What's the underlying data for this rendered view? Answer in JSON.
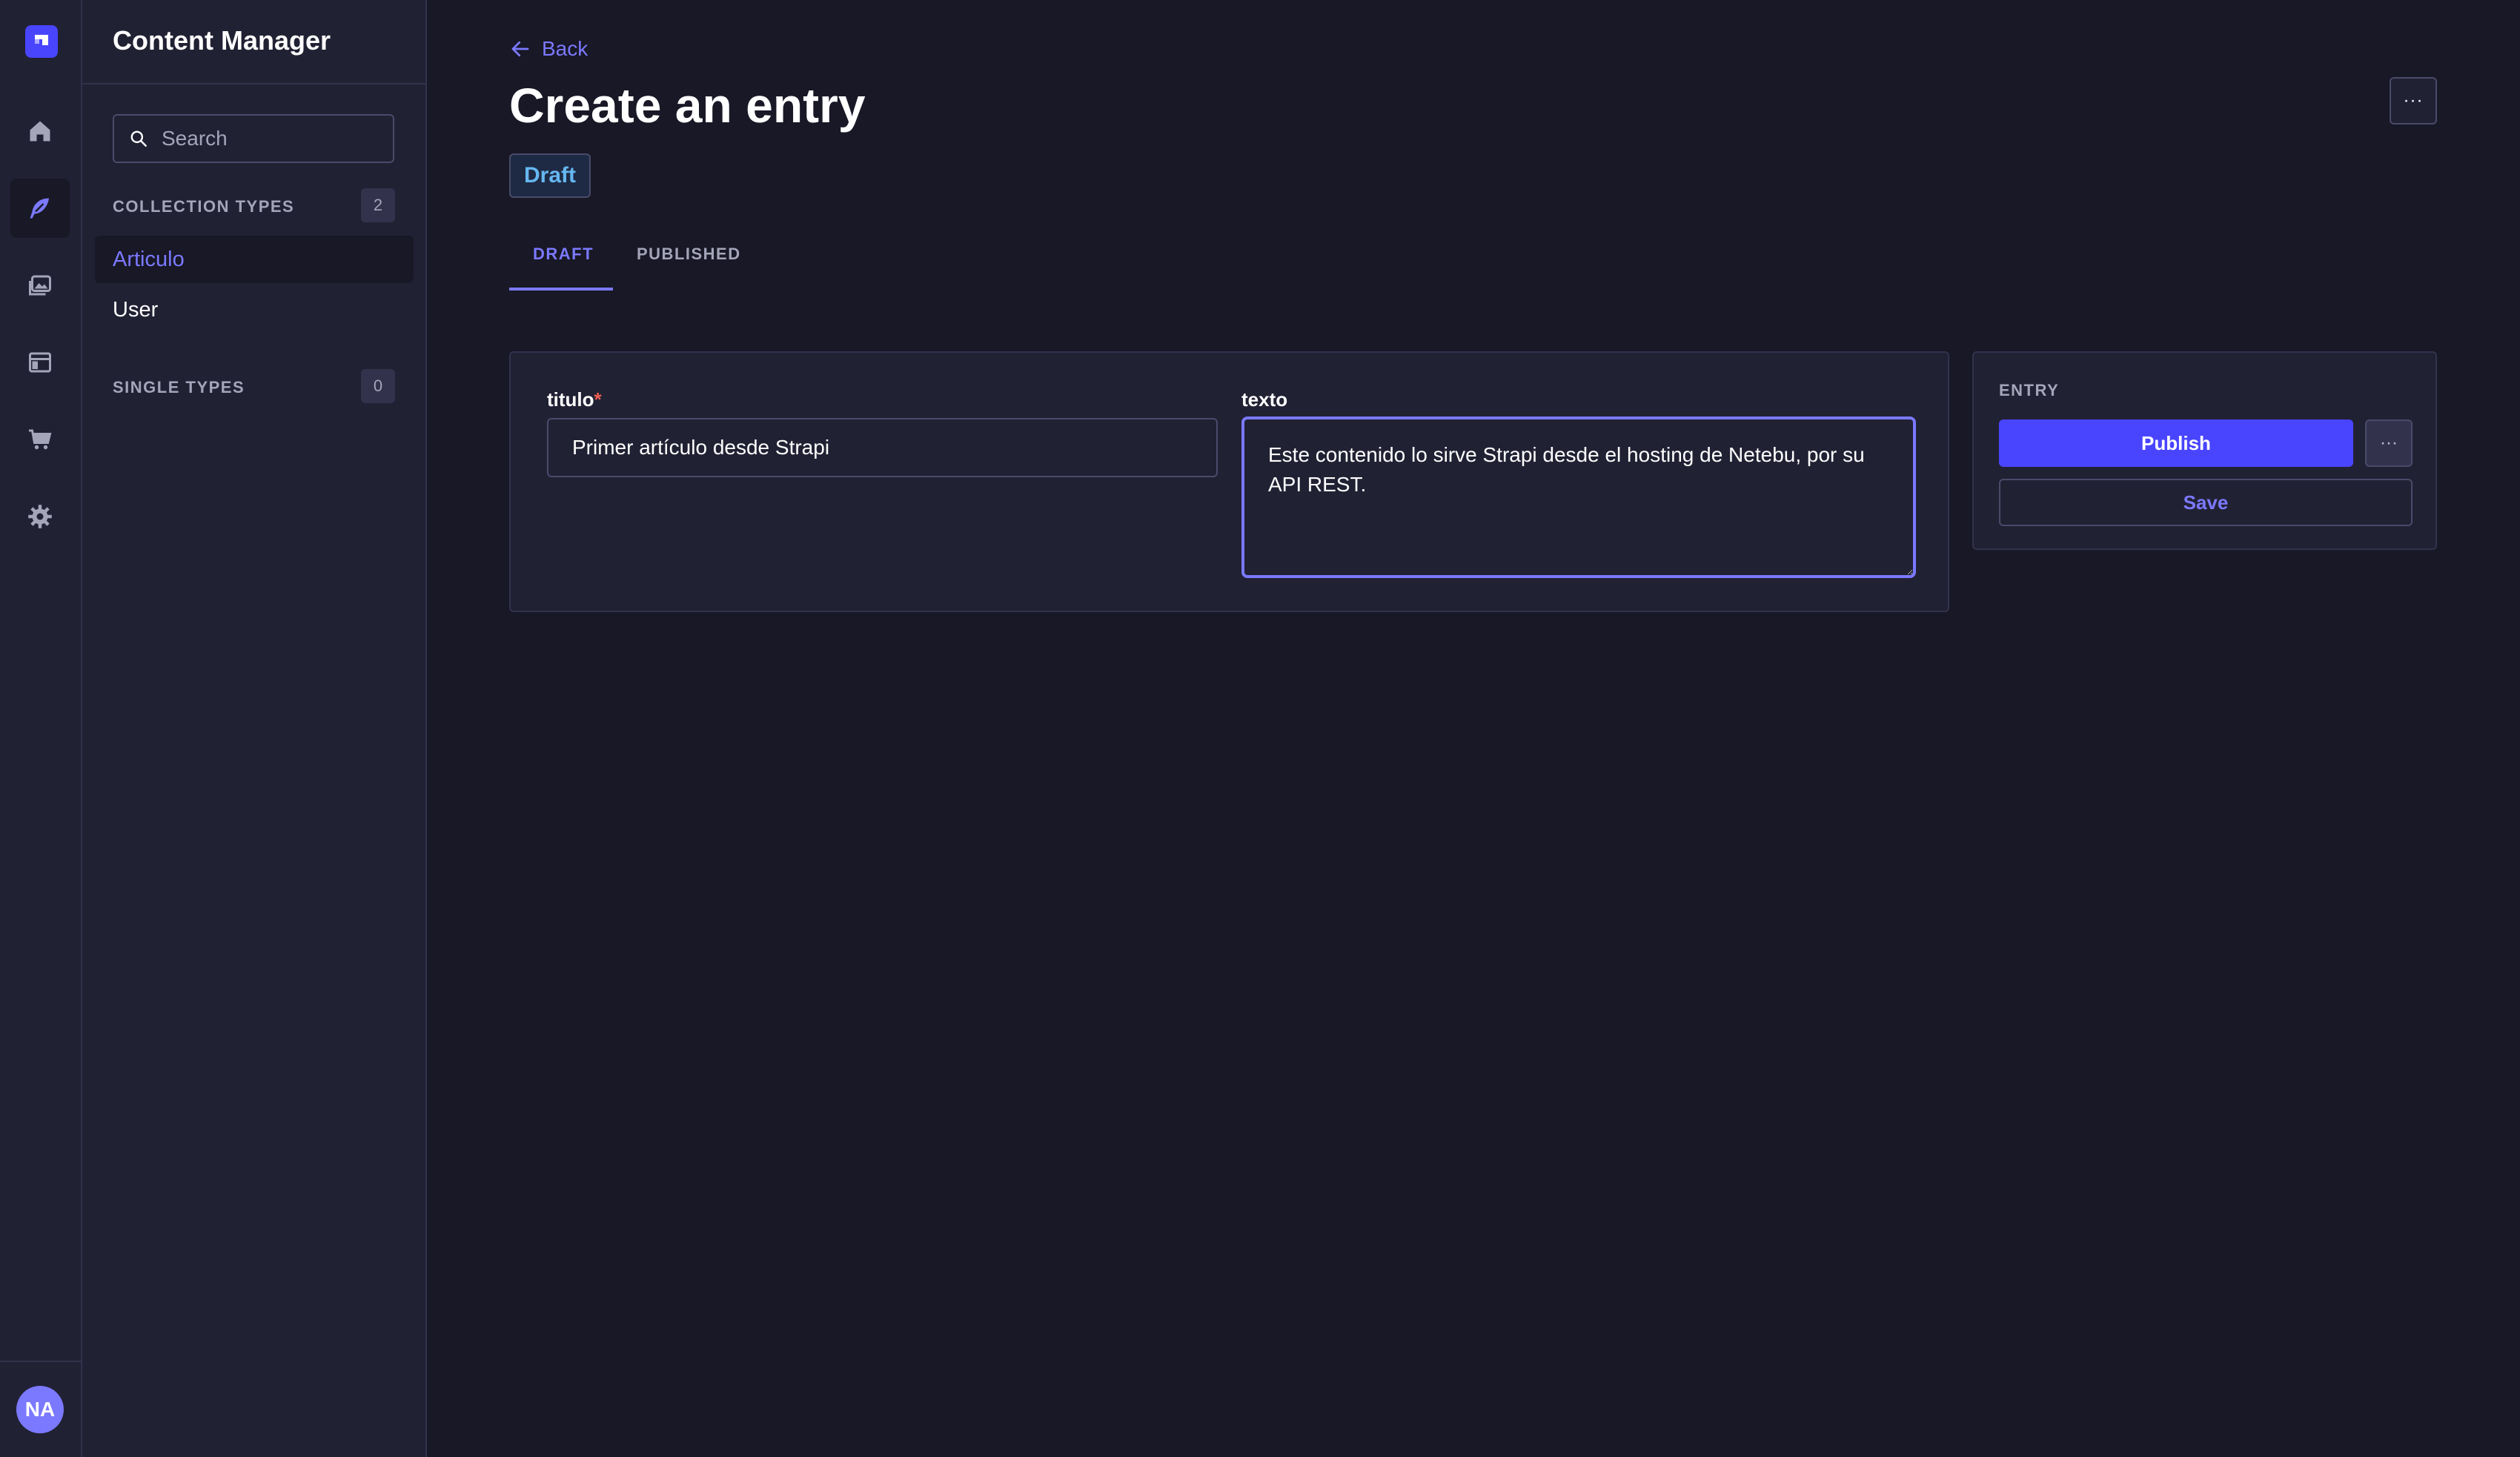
{
  "app": {
    "section_title": "Content Manager",
    "user_initials": "NA",
    "brand_color": "#4945ff",
    "accent_color": "#7b79ff"
  },
  "rail": {
    "items": [
      {
        "name": "home-icon"
      },
      {
        "name": "content-manager-icon",
        "active": true
      },
      {
        "name": "media-library-icon"
      },
      {
        "name": "content-type-builder-icon"
      },
      {
        "name": "marketplace-icon"
      },
      {
        "name": "settings-icon"
      }
    ]
  },
  "sidebar": {
    "search_placeholder": "Search",
    "collection_types": {
      "heading": "COLLECTION TYPES",
      "count": "2",
      "items": [
        {
          "label": "Articulo",
          "active": true
        },
        {
          "label": "User"
        }
      ]
    },
    "single_types": {
      "heading": "SINGLE TYPES",
      "count": "0"
    }
  },
  "header": {
    "back_label": "Back",
    "title": "Create an entry",
    "status": "Draft",
    "more_label": "···"
  },
  "tabs": [
    {
      "label": "DRAFT",
      "active": true
    },
    {
      "label": "PUBLISHED"
    }
  ],
  "form": {
    "titulo": {
      "label": "titulo",
      "required_mark": "*",
      "value": "Primer artículo desde Strapi"
    },
    "texto": {
      "label": "texto",
      "value": "Este contenido lo sirve Strapi desde el hosting de Netebu, por su API REST."
    }
  },
  "entry_panel": {
    "heading": "ENTRY",
    "publish_label": "Publish",
    "more_label": "···",
    "save_label": "Save"
  }
}
